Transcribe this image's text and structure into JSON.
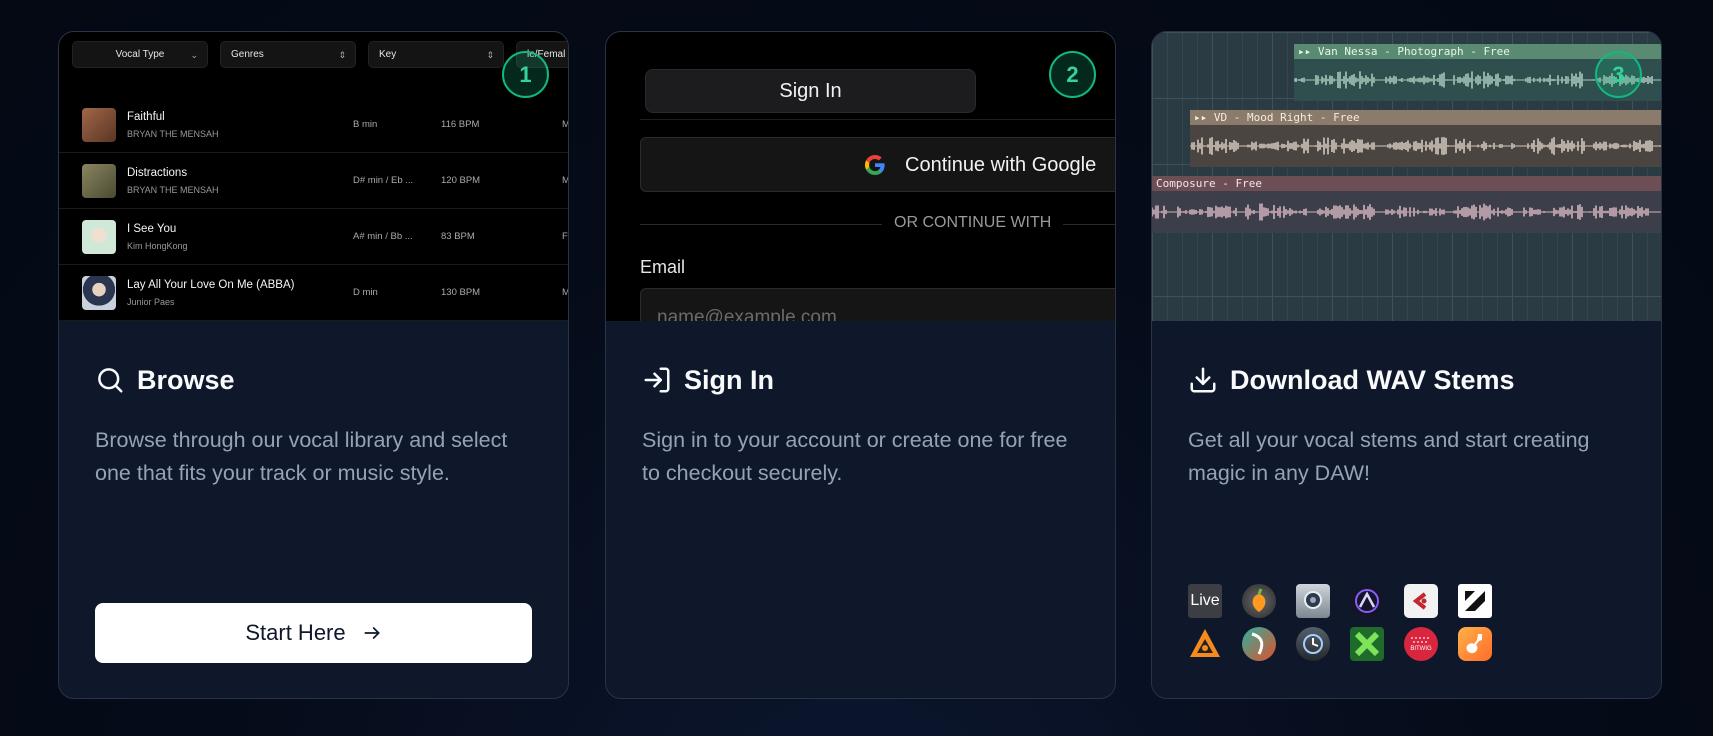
{
  "cards": [
    {
      "step": "1",
      "title": "Browse",
      "description": "Browse through our vocal library and select one that fits your track or music style.",
      "icon": "search-icon",
      "preview": {
        "filters": [
          {
            "label": "Vocal Type",
            "icon": "chevron-down-icon"
          },
          {
            "label": "Genres",
            "icon": "chevron-updown-icon"
          },
          {
            "label": "Key",
            "icon": "chevron-updown-icon"
          },
          {
            "label": "le/Femal",
            "icon": ""
          }
        ],
        "tracks": [
          {
            "name": "Faithful",
            "artist": "BRYAN THE MENSAH",
            "key": "B min",
            "bpm": "116 BPM",
            "gender": "M",
            "thumb_color": "#8a5a3c"
          },
          {
            "name": "Distractions",
            "artist": "BRYAN THE MENSAH",
            "key": "D# min / Eb ...",
            "bpm": "120 BPM",
            "gender": "M",
            "thumb_color": "#6f6a4a"
          },
          {
            "name": "I See You",
            "artist": "Kim HongKong",
            "key": "A# min / Bb ...",
            "bpm": "83 BPM",
            "gender": "Fe",
            "thumb_color": "#cfe8d8"
          },
          {
            "name": "Lay All Your Love On Me (ABBA)",
            "artist": "Junior Paes",
            "key": "D min",
            "bpm": "130 BPM",
            "gender": "M",
            "thumb_color": "#c9d2dc"
          }
        ]
      },
      "button": {
        "label": "Start Here",
        "icon": "arrow-right-icon"
      }
    },
    {
      "step": "2",
      "title": "Sign In",
      "description": "Sign in to your account or create one for free to checkout securely.",
      "icon": "sign-in-icon",
      "preview": {
        "tab_label": "Sign In",
        "google_label": "Continue with Google",
        "divider_label": "OR CONTINUE WITH",
        "email_label": "Email",
        "email_placeholder": "name@example.com"
      }
    },
    {
      "step": "3",
      "title": "Download WAV Stems",
      "description": "Get all your vocal stems and start creating magic in any DAW!",
      "icon": "download-icon",
      "preview": {
        "clips": [
          {
            "label": "Van Nessa - Photograph - Free",
            "head_color": "#5a8a72",
            "body_color": "#2f4f4f",
            "wave_color": "#b9d9c9"
          },
          {
            "label": "VD - Mood Right - Free",
            "head_color": "#8a7b6b",
            "body_color": "#4a4540",
            "wave_color": "#e6dad0"
          },
          {
            "label": "Composure - Free",
            "head_color": "#6b4f55",
            "body_color": "#3c3f4a",
            "wave_color": "#e5c3cc"
          }
        ]
      },
      "daws": [
        "ableton-live-icon",
        "fl-studio-icon",
        "logic-pro-icon",
        "pro-tools-icon",
        "cubase-icon",
        "studio-one-icon",
        "reason-icon",
        "reaper-icon",
        "digital-performer-icon",
        "mixcraft-icon",
        "bitwig-icon",
        "garageband-icon"
      ],
      "daw_live_text": "Live",
      "daw_bitwig_text": "BITWIG"
    }
  ],
  "colors": {
    "accent": "#10b981",
    "card_bg": "#0f172a",
    "muted_text": "#94a3b8"
  }
}
